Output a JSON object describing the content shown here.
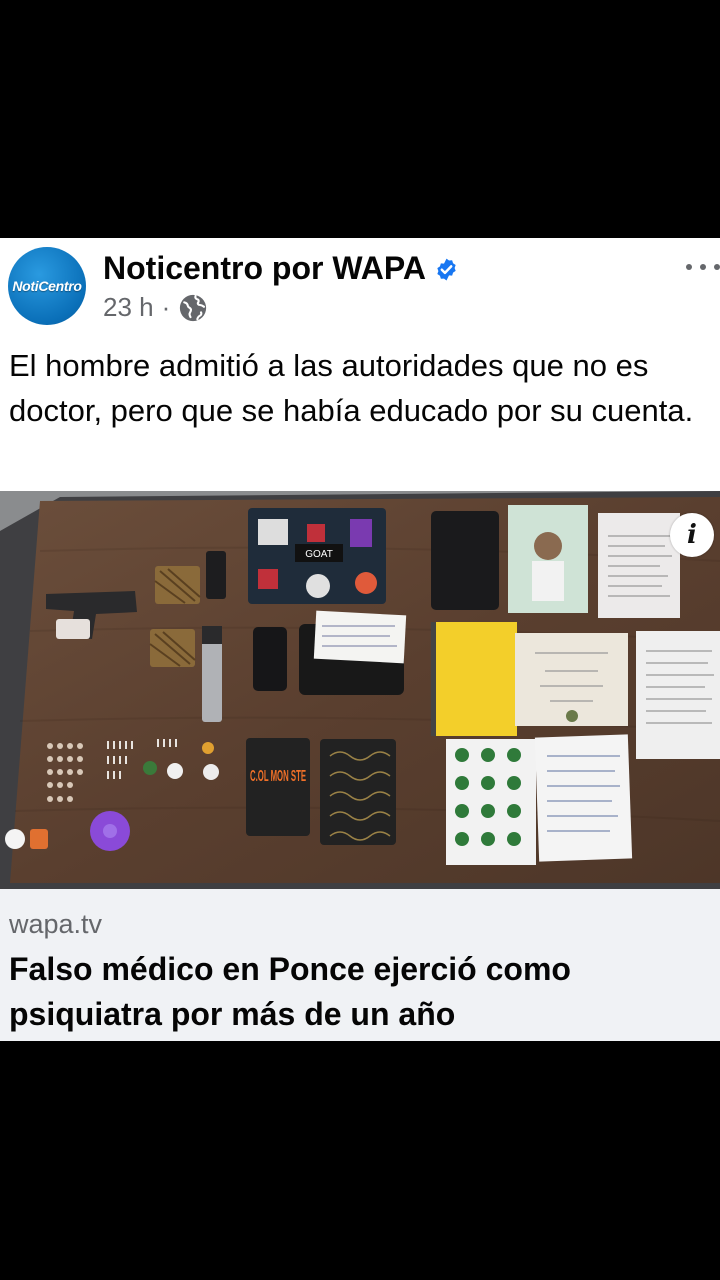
{
  "post": {
    "page_name": "Noticentro por WAPA",
    "avatar_text": "NotiCentro",
    "timestamp": "23 h",
    "separator": "·",
    "audience_icon": "globe-icon",
    "more_icon": "more-horizontal-icon",
    "verified_icon": "verified-badge-icon",
    "text": "El hombre admitió a las autoridades que no es doctor, pero que se había educado por su cuenta."
  },
  "photo": {
    "info_label": "i",
    "sticker_text": "GOAT",
    "notebook_text": "C.OL MON STE"
  },
  "link": {
    "domain": "wapa.tv",
    "title": "Falso médico en Ponce ejerció como psiquiatra por más de un año"
  },
  "colors": {
    "brand_blue": "#0a6fb8",
    "verified_blue": "#1877f2",
    "secondary_text": "#65676b",
    "preview_bg": "#f0f2f5"
  }
}
